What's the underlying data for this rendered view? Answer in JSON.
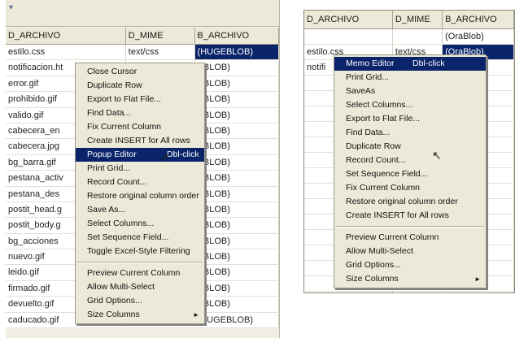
{
  "left_grid": {
    "headers": [
      "D_ARCHIVO",
      "D_MIME",
      "B_ARCHIVO"
    ],
    "rows": [
      [
        "estilo.css",
        "text/css",
        "(HUGEBLOB)"
      ],
      [
        "notificacion.ht",
        "",
        "EBLOB)"
      ],
      [
        "error.gif",
        "",
        "EBLOB)"
      ],
      [
        "prohibido.gif",
        "",
        "EBLOB)"
      ],
      [
        "valido.gif",
        "",
        "EBLOB)"
      ],
      [
        "cabecera_en",
        "",
        "EBLOB)"
      ],
      [
        "cabecera.jpg",
        "",
        "EBLOB)"
      ],
      [
        "bg_barra.gif",
        "",
        "EBLOB)"
      ],
      [
        "pestana_activ",
        "",
        "EBLOB)"
      ],
      [
        "pestana_des",
        "",
        "EBLOB)"
      ],
      [
        "postit_head.g",
        "",
        "EBLOB)"
      ],
      [
        "postit_body.g",
        "",
        "EBLOB)"
      ],
      [
        "bg_acciones",
        "",
        "EBLOB)"
      ],
      [
        "nuevo.gif",
        "",
        "EBLOB)"
      ],
      [
        "leido.gif",
        "",
        "EBLOB)"
      ],
      [
        "firmado.gif",
        "",
        "EBLOB)"
      ],
      [
        "devuelto.gif",
        "",
        "EBLOB)"
      ],
      [
        "caducado.gif",
        "image/gif",
        "(HUGEBLOB)"
      ]
    ]
  },
  "left_menu": {
    "items": [
      {
        "label": "Close Cursor"
      },
      {
        "label": "Duplicate Row"
      },
      {
        "label": "Export to Flat File..."
      },
      {
        "label": "Find Data..."
      },
      {
        "label": "Fix Current Column"
      },
      {
        "label": "Create INSERT for All rows"
      },
      {
        "label": "Popup Editor",
        "shortcut": "Dbl-click",
        "highlight": true
      },
      {
        "label": "Print Grid..."
      },
      {
        "label": "Record Count..."
      },
      {
        "label": "Restore original column order"
      },
      {
        "label": "Save As..."
      },
      {
        "label": "Select Columns..."
      },
      {
        "label": "Set Sequence Field..."
      },
      {
        "label": "Toggle Excel-Style Filtering"
      },
      {
        "sep": true
      },
      {
        "label": "Preview Current Column"
      },
      {
        "label": "Allow Multi-Select"
      },
      {
        "label": "Grid Options..."
      },
      {
        "label": "Size Columns",
        "submenu": true
      }
    ]
  },
  "right_grid": {
    "headers": [
      "D_ARCHIVO",
      "D_MIME",
      "B_ARCHIVO"
    ],
    "rows": [
      [
        "",
        "",
        "(OraBlob)"
      ],
      [
        "estilo.css",
        "text/css",
        "(OraBlob)"
      ],
      [
        "notifi",
        "",
        "Blob)"
      ],
      [
        "",
        "",
        "ob)"
      ],
      [
        "",
        "",
        "ob)"
      ],
      [
        "",
        "",
        "ob)"
      ],
      [
        "",
        "",
        "ob)"
      ],
      [
        "",
        "",
        "ob)"
      ],
      [
        "",
        "",
        "ob)"
      ],
      [
        "",
        "",
        "ob)"
      ],
      [
        "",
        "",
        "ob)"
      ],
      [
        "",
        "",
        "ob)"
      ],
      [
        "",
        "",
        "ob)"
      ],
      [
        "",
        "",
        "ob)"
      ],
      [
        "",
        "",
        "ob)"
      ],
      [
        "",
        "",
        "ob)"
      ],
      [
        "",
        "",
        "ob)"
      ],
      [
        "",
        "",
        "ob)"
      ]
    ]
  },
  "right_menu": {
    "items": [
      {
        "label": "Memo Editor",
        "shortcut": "Dbl-click",
        "highlight": true
      },
      {
        "label": "Print Grid..."
      },
      {
        "label": "SaveAs"
      },
      {
        "label": "Select Columns..."
      },
      {
        "label": "Export to Flat File..."
      },
      {
        "label": "Find Data..."
      },
      {
        "label": "Duplicate Row"
      },
      {
        "label": "Record Count..."
      },
      {
        "label": "Set Sequence Field..."
      },
      {
        "label": "Fix Current Column"
      },
      {
        "label": "Restore original column order"
      },
      {
        "label": "Create INSERT for All rows"
      },
      {
        "sep": true
      },
      {
        "label": "Preview Current Column"
      },
      {
        "label": "Allow Multi-Select"
      },
      {
        "label": "Grid Options..."
      },
      {
        "label": "Size Columns",
        "submenu": true
      }
    ]
  },
  "colors": {
    "selection": "#0a246a",
    "menu_bg": "#ece9d8",
    "grid_bg": "#ffffff"
  },
  "icons": [
    "mouse-cursor-icon",
    "submenu-arrow-icon"
  ]
}
